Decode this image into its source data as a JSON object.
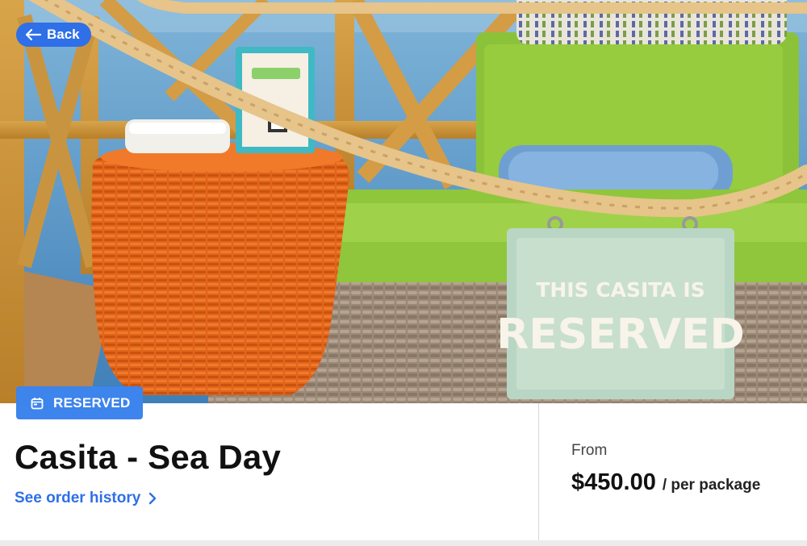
{
  "navigation": {
    "back_label": "Back"
  },
  "hero": {
    "image_alt": "Casita lounge bed with reserved sign",
    "sign_line1": "THIS CASITA IS",
    "sign_line2": "RESERVED"
  },
  "status": {
    "label": "RESERVED",
    "icon": "calendar-icon"
  },
  "product": {
    "title": "Casita - Sea Day",
    "order_history_label": "See order history"
  },
  "pricing": {
    "from_label": "From",
    "price": "$450.00",
    "unit": "/ per package"
  },
  "colors": {
    "accent": "#2f6fe8",
    "badge": "#3d84ec",
    "text": "#111111"
  }
}
